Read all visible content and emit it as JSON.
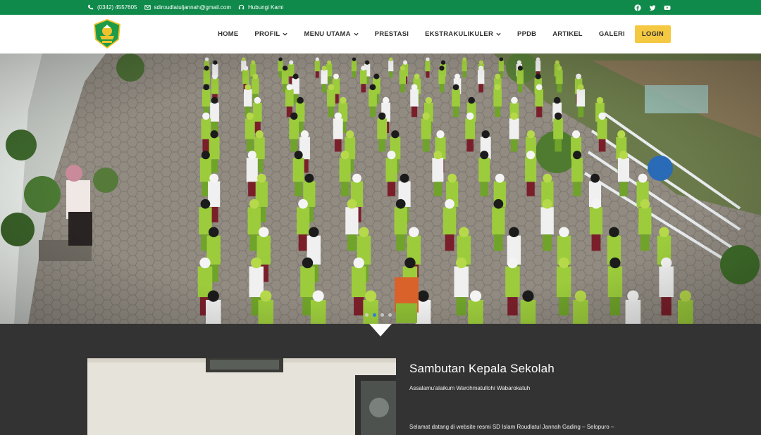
{
  "topbar": {
    "phone": "(0342) 4557605",
    "email": "sdiroudlatuljannah@gmail.com",
    "contact": "Hubungi Kami",
    "social": [
      "facebook-icon",
      "twitter-icon",
      "youtube-icon"
    ]
  },
  "nav": {
    "items": [
      {
        "label": "HOME",
        "dropdown": false
      },
      {
        "label": "PROFIL",
        "dropdown": true
      },
      {
        "label": "MENU UTAMA",
        "dropdown": true
      },
      {
        "label": "PRESTASI",
        "dropdown": false
      },
      {
        "label": "EKSTRAKULIKULER",
        "dropdown": true
      },
      {
        "label": "PPDB",
        "dropdown": false
      },
      {
        "label": "ARTIKEL",
        "dropdown": false
      },
      {
        "label": "GALERI",
        "dropdown": false
      }
    ],
    "login": "LOGIN"
  },
  "slider": {
    "slide_count": 4,
    "active_index": 1
  },
  "welcome": {
    "title": "Sambutan Kepala Sekolah",
    "greeting": "Assalamu'alaikum Warohmatullohi Wabarokatuh",
    "intro": "Selamat datang di website resmi SD Islam Roudlatul Jannah Gading – Selopuro –"
  },
  "colors": {
    "topbar": "#0f8a4b",
    "login": "#f5c842",
    "section": "#333333",
    "uniform_green": "#9ccc3c"
  }
}
